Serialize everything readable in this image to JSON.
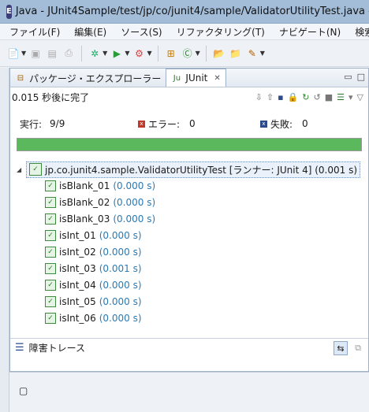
{
  "window": {
    "title": "Java - JUnit4Sample/test/jp/co/junit4/sample/ValidatorUtilityTest.java - Ec",
    "app_icon": "eclipse-icon"
  },
  "menu": [
    "ファイル(F)",
    "編集(E)",
    "ソース(S)",
    "リファクタリング(T)",
    "ナビゲート(N)",
    "検索("
  ],
  "tabs": [
    {
      "label": "パッケージ・エクスプローラー",
      "icon": "package-icon",
      "active": false
    },
    {
      "label": "JUnit",
      "icon": "junit-icon",
      "active": true
    }
  ],
  "junit": {
    "status": "0.015 秒後に完了",
    "runs_label": "実行:",
    "runs_value": "9/9",
    "errors_label": "エラー:",
    "errors_value": "0",
    "failures_label": "失敗:",
    "failures_value": "0",
    "progress": 1.0,
    "progress_color": "#5cb85c",
    "root": "jp.co.junit4.sample.ValidatorUtilityTest [ランナー: JUnit 4] (0.001 s)",
    "tests": [
      {
        "name": "isBlank_01",
        "time": "(0.000 s)"
      },
      {
        "name": "isBlank_02",
        "time": "(0.000 s)"
      },
      {
        "name": "isBlank_03",
        "time": "(0.000 s)"
      },
      {
        "name": "isInt_01",
        "time": "(0.000 s)"
      },
      {
        "name": "isInt_02",
        "time": "(0.000 s)"
      },
      {
        "name": "isInt_03",
        "time": "(0.001 s)"
      },
      {
        "name": "isInt_04",
        "time": "(0.000 s)"
      },
      {
        "name": "isInt_05",
        "time": "(0.000 s)"
      },
      {
        "name": "isInt_06",
        "time": "(0.000 s)"
      }
    ],
    "failure_trace_label": "障害トレース"
  }
}
